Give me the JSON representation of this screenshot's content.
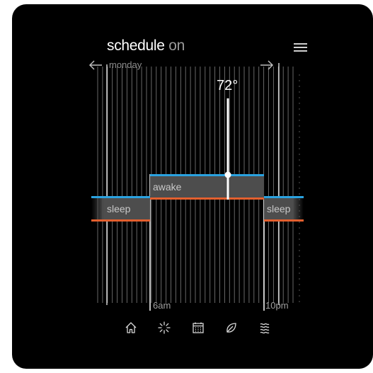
{
  "header": {
    "title": "schedule",
    "state": "on"
  },
  "day": {
    "label": "monday",
    "prev_icon": "arrow-left-icon",
    "next_icon": "arrow-right-icon"
  },
  "menu_icon": "hamburger-menu-icon",
  "setpoint": {
    "value_label": "72°"
  },
  "periods": [
    {
      "label": "sleep"
    },
    {
      "label": "awake"
    },
    {
      "label": "sleep"
    }
  ],
  "time_ticks": [
    "6am",
    "10pm"
  ],
  "nav": [
    "home-icon",
    "fan-icon",
    "calendar-icon",
    "leaf-icon",
    "heat-waves-icon"
  ],
  "colors": {
    "background": "#000000",
    "heat": "#e35f2e",
    "cool": "#2aa2e0",
    "period": "#4d4d4d",
    "text": "#ffffff"
  }
}
